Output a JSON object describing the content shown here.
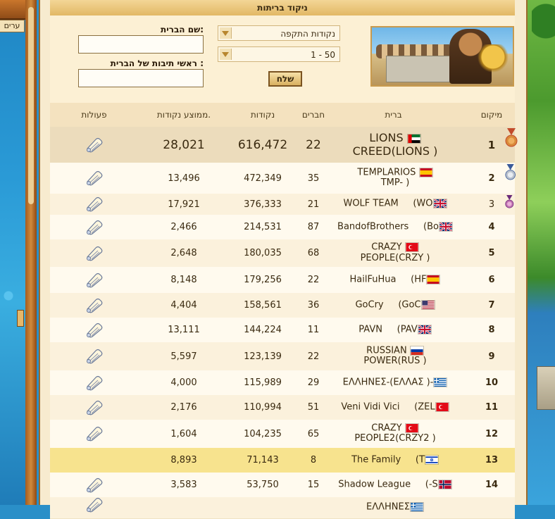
{
  "panel": {
    "title": "ניקוד בריתות"
  },
  "side": {
    "left_tab": "ערים"
  },
  "form": {
    "select_type": "נקודות התקפה",
    "select_range": "1 - 50",
    "send_label": "שלח",
    "name_label": "שם הברית:",
    "name_value": "",
    "tag_label": "ראשי תיבות של הברית :",
    "tag_value": ""
  },
  "table": {
    "headers": {
      "rank": "מיקום",
      "alliance": "ברית",
      "members": "חברים",
      "points": "נקודות",
      "avg": "ממוצע נקודות.",
      "actions": "פעולות"
    },
    "rows": [
      {
        "rank": "1",
        "name": "LIONS",
        "tag": "CREED(LIONS )",
        "flag": "ae",
        "members": "22",
        "points": "616,472",
        "avg": "28,021",
        "medal": "bronze",
        "big": true
      },
      {
        "rank": "2",
        "name": "TEMPLARIOS",
        "tag": "TMP- )",
        "flag": "es",
        "members": "35",
        "points": "472,349",
        "avg": "13,496",
        "medal": "silver"
      },
      {
        "rank": "3",
        "name": "WOLF TEAM",
        "tag": "(WO",
        "flag": "gb",
        "members": "21",
        "points": "376,333",
        "avg": "17,921",
        "medal": "purple"
      },
      {
        "rank": "4",
        "name": "BandofBrothers",
        "tag": "(Bo",
        "flag": "gb",
        "members": "87",
        "points": "214,531",
        "avg": "2,466"
      },
      {
        "rank": "5",
        "name": "CRAZY",
        "tag": "PEOPLE(CRZY )",
        "flag": "tr",
        "members": "68",
        "points": "180,035",
        "avg": "2,648"
      },
      {
        "rank": "6",
        "name": "HailFuHua",
        "tag": "(HF",
        "flag": "es",
        "members": "22",
        "points": "179,256",
        "avg": "8,148"
      },
      {
        "rank": "7",
        "name": "GoCry",
        "tag": "(GoC",
        "flag": "us",
        "members": "36",
        "points": "158,561",
        "avg": "4,404"
      },
      {
        "rank": "8",
        "name": "PAVN",
        "tag": "(PAV",
        "flag": "gb",
        "members": "11",
        "points": "144,224",
        "avg": "13,111"
      },
      {
        "rank": "9",
        "name": "RUSSIAN",
        "tag": "POWER(RUS )",
        "flag": "ru",
        "members": "22",
        "points": "123,139",
        "avg": "5,597"
      },
      {
        "rank": "10",
        "name": "ΕΛΛΗΝΕΣ-(ΕΛΛΑΣ )-",
        "tag": "",
        "flag": "gr",
        "members": "29",
        "points": "115,989",
        "avg": "4,000"
      },
      {
        "rank": "11",
        "name": "Veni Vidi Vici",
        "tag": "(ZEL",
        "flag": "tr",
        "members": "51",
        "points": "110,994",
        "avg": "2,176"
      },
      {
        "rank": "12",
        "name": "CRAZY",
        "tag": "PEOPLE2(CRZY2 )",
        "flag": "tr",
        "members": "65",
        "points": "104,235",
        "avg": "1,604"
      },
      {
        "rank": "13",
        "name": "The Family",
        "tag": "(T",
        "flag": "il",
        "members": "8",
        "points": "71,143",
        "avg": "8,893",
        "highlight": true
      },
      {
        "rank": "14",
        "name": "Shadow League",
        "tag": "(-S",
        "flag": "no",
        "members": "15",
        "points": "53,750",
        "avg": "3,583"
      },
      {
        "rank": "",
        "name": "ΕΛΛΗΝΕΣ",
        "tag": "",
        "flag": "gr",
        "members": "",
        "points": "",
        "avg": ""
      }
    ]
  },
  "colors": {
    "accent": "#e2b865",
    "highlight_row": "#f7e38e",
    "frame": "#9c6a2b"
  }
}
